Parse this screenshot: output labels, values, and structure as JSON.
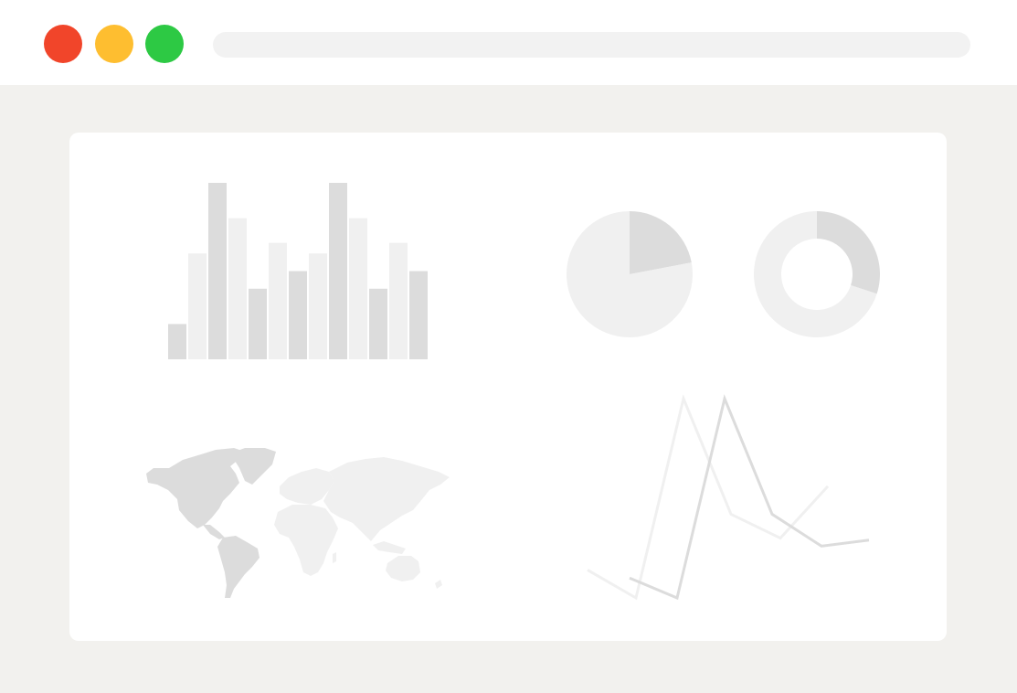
{
  "window": {
    "controls": [
      {
        "name": "close",
        "color": "#f1452a"
      },
      {
        "name": "minimize",
        "color": "#febe30"
      },
      {
        "name": "maximize",
        "color": "#2dc944"
      }
    ],
    "address_bar": {
      "value": ""
    }
  },
  "colors": {
    "dark_gray": "#dcdcdc",
    "light_gray": "#f0f0f0",
    "card": "#ffffff",
    "background": "#f2f1ee"
  },
  "chart_data": [
    {
      "type": "bar",
      "values": [
        20,
        60,
        100,
        80,
        40,
        66,
        50,
        60,
        100,
        80,
        40,
        66,
        50
      ],
      "value_shades": [
        "dark",
        "light",
        "dark",
        "light",
        "dark",
        "light",
        "dark",
        "light",
        "dark",
        "light",
        "dark",
        "light",
        "dark"
      ],
      "ylim": [
        0,
        100
      ]
    },
    {
      "type": "pie",
      "values": [
        22,
        78
      ],
      "slice_shades": [
        "dark",
        "light"
      ]
    },
    {
      "type": "pie",
      "variant": "donut",
      "values": [
        30,
        70
      ],
      "slice_shades": [
        "dark",
        "light"
      ]
    },
    {
      "type": "line",
      "x": [
        0,
        1,
        2,
        3,
        4,
        5
      ],
      "series": [
        {
          "values": [
            14,
            0,
            100,
            42,
            30,
            56
          ],
          "shade": "light"
        },
        {
          "values": [
            10,
            0,
            100,
            42,
            26,
            29
          ],
          "shade": "dark"
        }
      ],
      "ylim": [
        0,
        100
      ]
    }
  ]
}
